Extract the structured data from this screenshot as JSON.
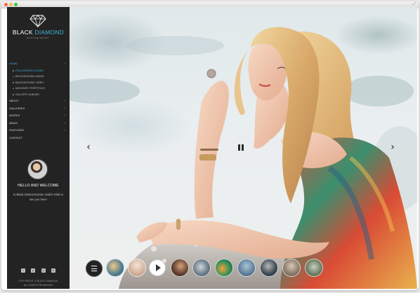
{
  "brand": {
    "title_main": "BLACK",
    "title_accent": "DIAMOND",
    "subtitle": "photographer"
  },
  "menu": {
    "items": [
      {
        "label": "HOME",
        "active": true
      },
      {
        "label": "ABOUT"
      },
      {
        "label": "GALLERIES"
      },
      {
        "label": "WORKS"
      },
      {
        "label": "NEWS"
      },
      {
        "label": "FEATURES"
      },
      {
        "label": "CONTACT"
      }
    ],
    "submenu": [
      {
        "label": "FULLSCREEN SLIDER",
        "active": true
      },
      {
        "label": "BACKGROUND IMAGE"
      },
      {
        "label": "BACKGROUND VIDEO"
      },
      {
        "label": "MASONRY PORTFOLIO"
      },
      {
        "label": "GALLERY ALBUMS"
      }
    ],
    "arrow": "›"
  },
  "welcome": {
    "title": "HELLO AND WELCOME",
    "text": "to Black Diamond photo studio! Glad to see you here!"
  },
  "socials": [
    {
      "icon": "facebook-icon",
      "glyph": "f"
    },
    {
      "icon": "pinterest-icon",
      "glyph": "p"
    },
    {
      "icon": "instagram-icon",
      "glyph": "◎"
    },
    {
      "icon": "linkedin-icon",
      "glyph": "in"
    }
  ],
  "copyright": {
    "line1": "COPYRIGHT © BLACK DIAMOND",
    "line2": "ALL RIGHTS RESERVED"
  },
  "slider": {
    "prev_glyph": "‹",
    "next_glyph": "›"
  },
  "colors": {
    "accent": "#37b3d8",
    "sidebar_bg": "#232323"
  }
}
